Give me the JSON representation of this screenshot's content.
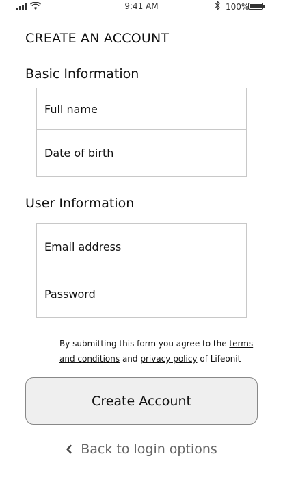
{
  "status_bar": {
    "time": "9:41 AM",
    "battery_percent": "100%",
    "battery_level": 1.0,
    "icons": [
      "signal-icon",
      "wifi-icon",
      "bluetooth-icon",
      "battery-icon"
    ]
  },
  "page": {
    "title": "CREATE AN ACCOUNT"
  },
  "basic_info": {
    "heading": "Basic Information",
    "fields": [
      {
        "label": "Full name"
      },
      {
        "label": "Date of birth"
      }
    ]
  },
  "user_info": {
    "heading": "User Information",
    "fields": [
      {
        "label": "Email address"
      },
      {
        "label": "Password"
      }
    ]
  },
  "terms": {
    "prefix": "By submitting this form you agree to the ",
    "terms_link": "terms and conditions",
    "middle": " and ",
    "privacy_link": "privacy policy",
    "suffix": " of Lifeonit"
  },
  "actions": {
    "create_label": "Create Account",
    "back_label": "Back to login options",
    "back_icon": "chevron-left-icon"
  }
}
